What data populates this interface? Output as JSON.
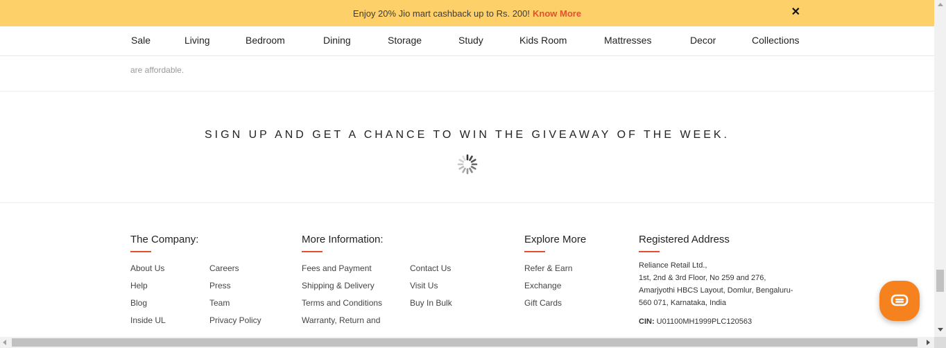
{
  "promo": {
    "text": "Enjoy 20% Jio mart cashback up to Rs. 200!",
    "link": "Know More",
    "close": "✕"
  },
  "nav": {
    "items": [
      "Sale",
      "Living",
      "Bedroom",
      "Dining",
      "Storage",
      "Study",
      "Kids Room",
      "Mattresses",
      "Decor",
      "Collections"
    ]
  },
  "content": {
    "partial_text": "are affordable."
  },
  "signup": {
    "heading": "SIGN UP AND GET A CHANCE TO WIN THE GIVEAWAY OF THE WEEK."
  },
  "footer": {
    "company": {
      "heading": "The Company:",
      "col1": [
        "About Us",
        "Help",
        "Blog",
        "Inside UL"
      ],
      "col2": [
        "Careers",
        "Press",
        "Team",
        "Privacy Policy"
      ]
    },
    "more_info": {
      "heading": "More Information:",
      "col1": [
        "Fees and Payment",
        "Shipping & Delivery",
        "Terms and Conditions",
        "Warranty, Return and"
      ],
      "col2": [
        "Contact Us",
        "Visit Us",
        "Buy In Bulk"
      ]
    },
    "explore": {
      "heading": "Explore More",
      "items": [
        "Refer & Earn",
        "Exchange",
        "Gift Cards"
      ]
    },
    "address": {
      "heading": "Registered Address",
      "lines": [
        "Reliance Retail Ltd.,",
        "1st, 2nd & 3rd Floor, No 259 and 276,",
        "Amarjyothi HBCS Layout, Domlur, Bengaluru-",
        "560 071, Karnataka, India"
      ],
      "cin_label": "CIN:",
      "cin_value": "U01100MH1999PLC120563"
    }
  },
  "colors": {
    "promo_bg": "#fdd069",
    "accent": "#e4502f",
    "chat_bg": "#f5811f"
  },
  "icons": {
    "close": "close-icon",
    "spinner": "loading-spinner-icon",
    "chat": "chat-icon"
  }
}
